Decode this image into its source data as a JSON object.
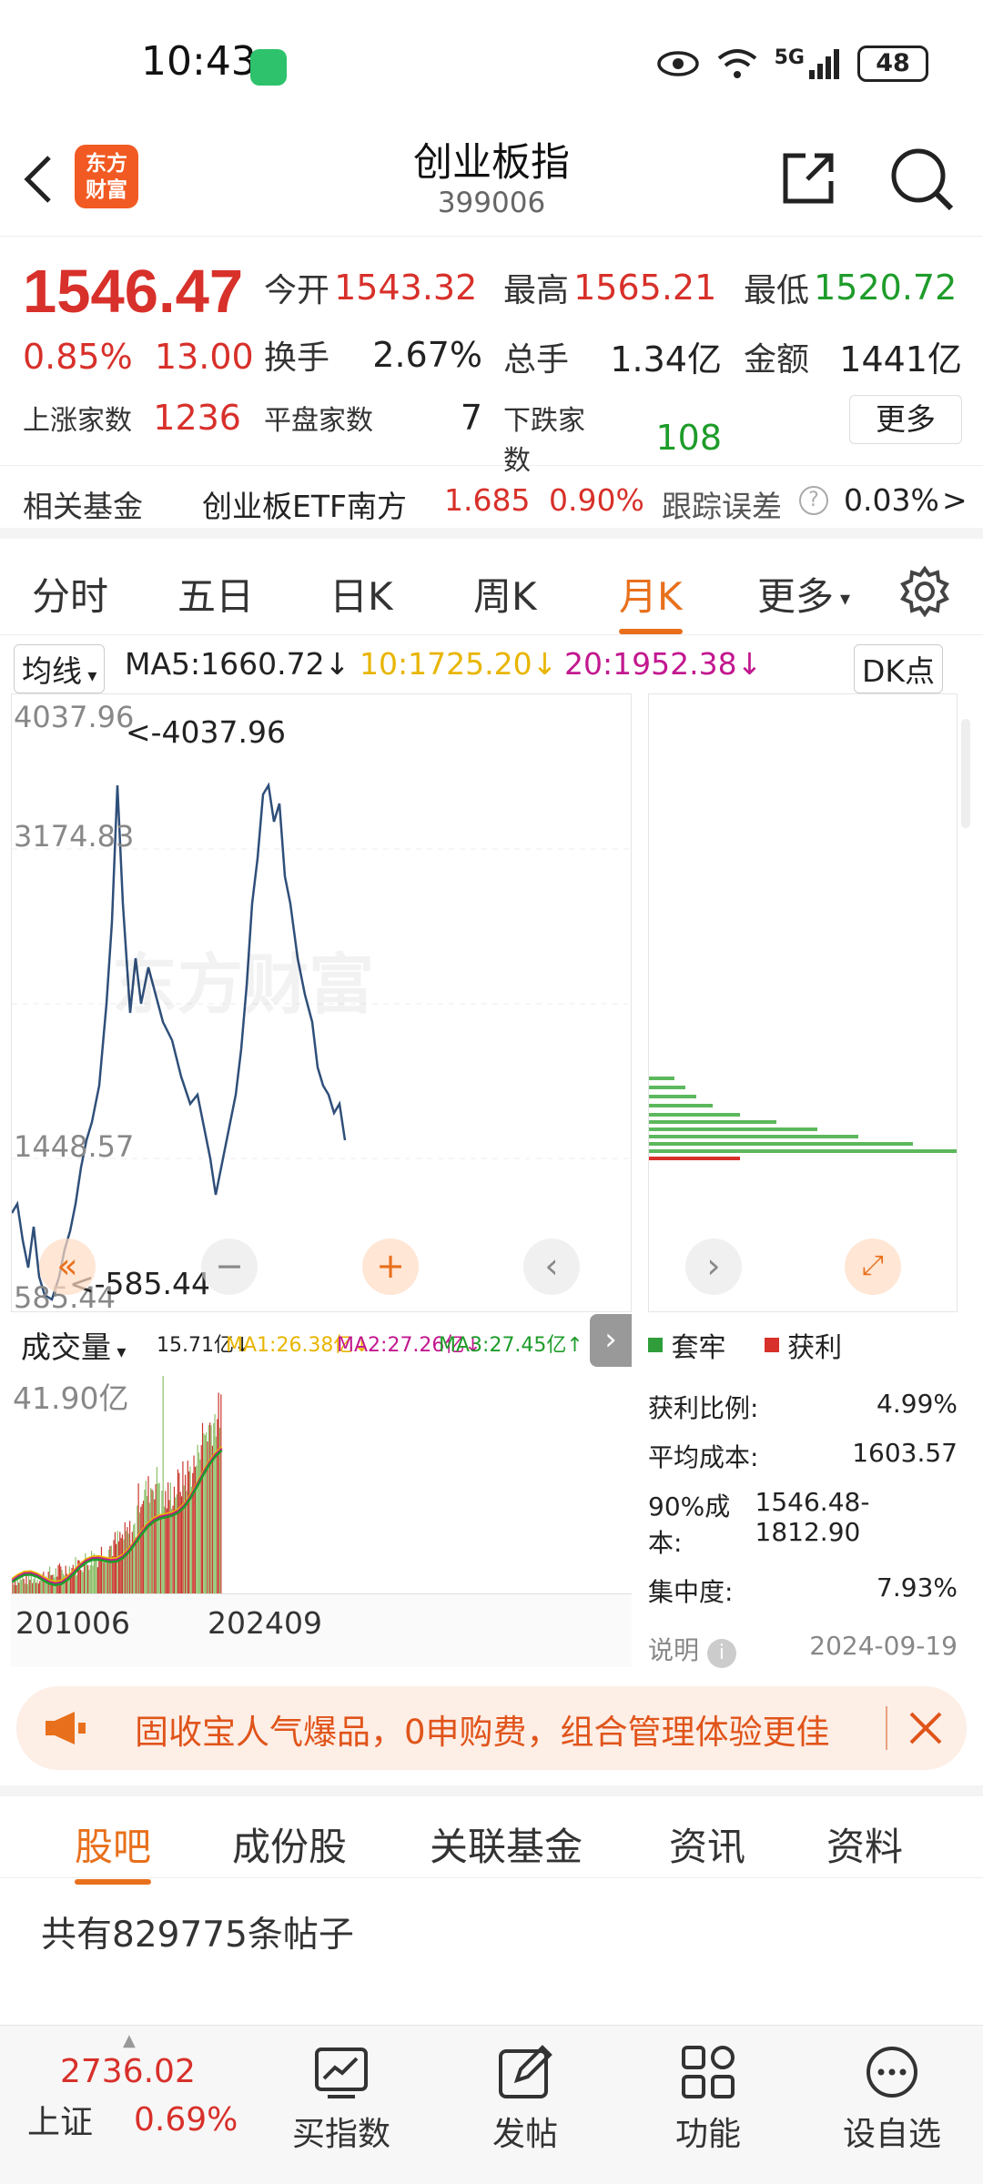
{
  "status_bar": {
    "time": "10:43",
    "network": "5G",
    "battery": "48"
  },
  "header": {
    "logo_text_1": "东方",
    "logo_text_2": "财富",
    "title": "创业板指",
    "code": "399006"
  },
  "quote": {
    "price": "1546.47",
    "change_pct": "0.85%",
    "change": "13.00",
    "open_label": "今开",
    "open": "1543.32",
    "high_label": "最高",
    "high": "1565.21",
    "low_label": "最低",
    "low": "1520.72",
    "turnover_label": "换手",
    "turnover": "2.67%",
    "volume_label": "总手",
    "volume": "1.34亿",
    "amount_label": "金额",
    "amount": "1441亿",
    "up_label": "上涨家数",
    "up": "1236",
    "flat_label": "平盘家数",
    "flat": "7",
    "down_label": "下跌家数",
    "down": "108",
    "more_label": "更多"
  },
  "fund": {
    "label": "相关基金",
    "name": "创业板ETF南方",
    "price": "1.685",
    "pct": "0.90%",
    "err_label": "跟踪误差",
    "err": "0.03%",
    "arrow": ">"
  },
  "periods": {
    "t1": "分时",
    "t2": "五日",
    "t3": "日K",
    "t4": "周K",
    "t5": "月K",
    "t6": "更多"
  },
  "ma": {
    "selector": "均线",
    "ma5": "MA5:1660.72",
    "ma10": "10:1725.20",
    "ma20": "20:1952.38",
    "down": "↓",
    "dk": "DK点"
  },
  "kchart": {
    "y_max": "4037.96",
    "y2": "3174.83",
    "y4": "1448.57",
    "y_min": "585.44",
    "max_marker": "<-4037.96",
    "min_marker": "<-585.44",
    "watermark": "东方财富",
    "line_color": "#2f4f7a"
  },
  "volume": {
    "selector": "成交量",
    "vol": "15.71亿↓",
    "ma1": "MA1:26.38亿↓",
    "ma2": "MA2:27.26亿↓",
    "ma3": "MA3:27.45亿↑",
    "max": "41.90亿",
    "x_start": "201006",
    "x_end": "202409"
  },
  "chip": {
    "legend_trap": "套牢",
    "legend_profit": "获利",
    "profit_ratio_label": "获利比例:",
    "profit_ratio": "4.99%",
    "avg_cost_label": "平均成本:",
    "avg_cost": "1603.57",
    "cost90_label": "90%成本:",
    "cost90": "1546.48-1812.90",
    "concentration_label": "集中度:",
    "concentration": "7.93%",
    "note_label": "说明",
    "date": "2024-09-19"
  },
  "ad": {
    "text": "固收宝人气爆品，0申购费，组合管理体验更佳"
  },
  "bottom_tabs": {
    "t1": "股吧",
    "t2": "成份股",
    "t3": "关联基金",
    "t4": "资讯",
    "t5": "资料"
  },
  "posts": {
    "text": "共有829775条帖子"
  },
  "bottom_nav": {
    "sh_value": "2736.02",
    "sh_label": "上证",
    "sh_pct": "0.69%",
    "buy_label": "买指数",
    "post_label": "发帖",
    "func_label": "功能",
    "watch_label": "设自选"
  },
  "colors": {
    "accent": "#e8701c",
    "up": "#d8302a",
    "down": "#1e9c2a"
  }
}
